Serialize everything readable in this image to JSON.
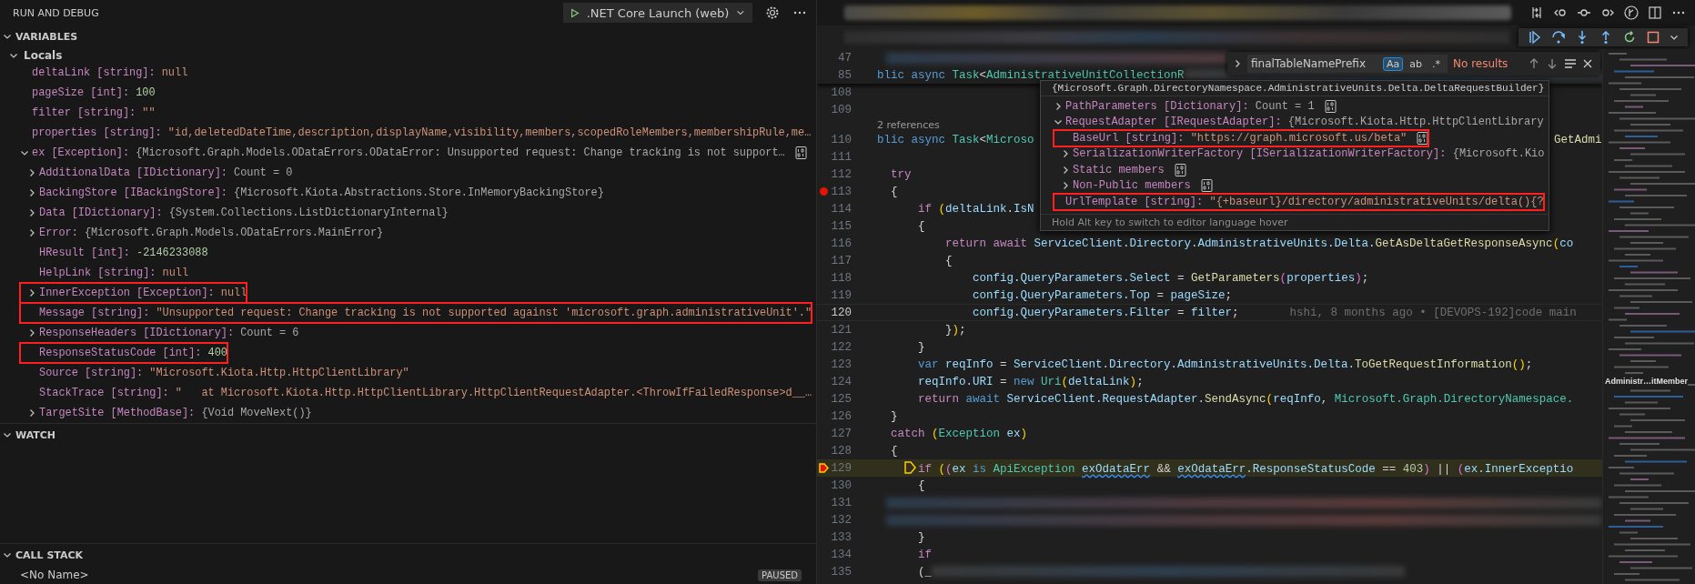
{
  "sidebar": {
    "title": "RUN AND DEBUG",
    "launch_config": ".NET Core Launch (web)",
    "variables": {
      "title": "VARIABLES",
      "expanded": true,
      "scopes": [
        {
          "name": "Locals",
          "expanded": true,
          "items": [
            {
              "name": "deltaLink",
              "type": "[string]:",
              "value": "null",
              "kind": "string",
              "expandable": false,
              "highlighted": false
            },
            {
              "name": "pageSize",
              "type": "[int]:",
              "value": "100",
              "kind": "number",
              "expandable": false,
              "highlighted": false
            },
            {
              "name": "filter",
              "type": "[string]:",
              "value": "\"\"",
              "kind": "string",
              "expandable": false,
              "highlighted": false
            },
            {
              "name": "properties",
              "type": "[string]:",
              "value": "\"id,deletedDateTime,description,displayName,visibility,members,scopedRoleMembers,membershipRule,me…",
              "kind": "string",
              "expandable": false,
              "highlighted": false
            },
            {
              "name": "ex",
              "type": "[Exception]:",
              "value": "{Microsoft.Graph.Models.ODataErrors.ODataError: Unsupported request: Change tracking is not support…",
              "kind": "object",
              "expandable": true,
              "expanded": true,
              "copy_button": true,
              "highlighted": false,
              "children": [
                {
                  "name": "AdditionalData",
                  "type": "[IDictionary]:",
                  "value": "Count = 0",
                  "kind": "object",
                  "expandable": true,
                  "expanded": false,
                  "highlighted": false
                },
                {
                  "name": "BackingStore",
                  "type": "[IBackingStore]:",
                  "value": "{Microsoft.Kiota.Abstractions.Store.InMemoryBackingStore}",
                  "kind": "object",
                  "expandable": true,
                  "expanded": false,
                  "highlighted": false
                },
                {
                  "name": "Data",
                  "type": "[IDictionary]:",
                  "value": "{System.Collections.ListDictionaryInternal}",
                  "kind": "object",
                  "expandable": true,
                  "expanded": false,
                  "highlighted": false
                },
                {
                  "name": "Error:",
                  "value": "{Microsoft.Graph.Models.ODataErrors.MainError}",
                  "kind": "object",
                  "expandable": true,
                  "expanded": false,
                  "highlighted": false
                },
                {
                  "name": "HResult",
                  "type": "[int]:",
                  "value": "-2146233088",
                  "kind": "number",
                  "expandable": false,
                  "highlighted": false
                },
                {
                  "name": "HelpLink",
                  "type": "[string]:",
                  "value": "null",
                  "kind": "string",
                  "expandable": false,
                  "highlighted": false
                },
                {
                  "name": "InnerException",
                  "type": "[Exception]:",
                  "value": "null",
                  "kind": "string",
                  "expandable": true,
                  "expanded": false,
                  "highlighted": true
                },
                {
                  "name": "Message",
                  "type": "[string]:",
                  "value": "\"Unsupported request: Change tracking is not supported against 'microsoft.graph.administrativeUnit'.\"",
                  "kind": "string",
                  "expandable": false,
                  "highlighted": true
                },
                {
                  "name": "ResponseHeaders",
                  "type": "[IDictionary]:",
                  "value": "Count = 6",
                  "kind": "object",
                  "expandable": true,
                  "expanded": false,
                  "highlighted": false
                },
                {
                  "name": "ResponseStatusCode",
                  "type": "[int]:",
                  "value": "400",
                  "kind": "number",
                  "expandable": false,
                  "highlighted": true
                },
                {
                  "name": "Source",
                  "type": "[string]:",
                  "value": "\"Microsoft.Kiota.Http.HttpClientLibrary\"",
                  "kind": "string",
                  "expandable": false,
                  "highlighted": false
                },
                {
                  "name": "StackTrace",
                  "type": "[string]:",
                  "value": "\"   at Microsoft.Kiota.Http.HttpClientLibrary.HttpClientRequestAdapter.<ThrowIfFailedResponse>d__…",
                  "kind": "string",
                  "expandable": false,
                  "highlighted": false
                },
                {
                  "name": "TargetSite",
                  "type": "[MethodBase]:",
                  "value": "{Void MoveNext()}",
                  "kind": "object",
                  "expandable": true,
                  "expanded": false,
                  "highlighted": false
                }
              ]
            }
          ]
        }
      ]
    },
    "watch": {
      "title": "WATCH",
      "expanded": true
    },
    "call_stack": {
      "title": "CALL STACK",
      "expanded": true,
      "frames": [
        {
          "name": "<No Name>",
          "badge": "PAUSED"
        }
      ]
    }
  },
  "editor": {
    "sticky_lines": [
      {
        "number": "47",
        "kind": "blurred"
      },
      {
        "number": "85",
        "kind": "normal",
        "tokens": [
          {
            "text": "blic async ",
            "kind": "kw"
          },
          {
            "text": "Task",
            "kind": "type"
          },
          {
            "text": "<",
            "kind": "p"
          },
          {
            "text": "AdministrativeUnitCollectionR",
            "kind": "type"
          },
          {
            "kind": "blur"
          }
        ]
      }
    ],
    "lines": [
      {
        "number": "108",
        "kind": "normal"
      },
      {
        "number": "109",
        "kind": "normal"
      },
      {
        "kind": "codelens",
        "text": "2 references"
      },
      {
        "number": "110",
        "kind": "normal",
        "tokens": [
          {
            "text": "blic async ",
            "kind": "kw"
          },
          {
            "text": "Task",
            "kind": "type"
          },
          {
            "text": "<",
            "kind": "p"
          },
          {
            "text": "Microso",
            "kind": "type"
          },
          {
            "text": "GetAdmi",
            "kind": "after_popup"
          }
        ]
      },
      {
        "number": "111",
        "kind": "normal"
      },
      {
        "number": "112",
        "kind": "normal",
        "tokens": [
          {
            "text": "  try",
            "kind": "ctl"
          }
        ]
      },
      {
        "number": "113",
        "kind": "breakpoint",
        "tokens": [
          {
            "text": "  {",
            "kind": "p"
          }
        ]
      },
      {
        "number": "114",
        "kind": "normal",
        "tokens": [
          {
            "text": "      if ",
            "kind": "ctl"
          },
          {
            "text": "(",
            "kind": "b1"
          },
          {
            "text": "deltaLink",
            "kind": "var"
          },
          {
            "text": ".",
            "kind": "p"
          },
          {
            "text": "IsN",
            "kind": "var"
          }
        ]
      },
      {
        "number": "115",
        "kind": "normal",
        "tokens": [
          {
            "text": "      {",
            "kind": "p"
          }
        ]
      },
      {
        "number": "116",
        "kind": "normal",
        "tokens": [
          {
            "text": "          return await ",
            "kind": "ctl"
          },
          {
            "text": "ServiceClient.Directory.AdministrativeUnits.Delta.",
            "kind": "var"
          },
          {
            "text": "GetAsDeltaGetResponseAsync",
            "kind": "fn"
          },
          {
            "text": "(",
            "kind": "b1"
          },
          {
            "text": "co",
            "kind": "var"
          }
        ]
      },
      {
        "number": "117",
        "kind": "normal",
        "tokens": [
          {
            "text": "          {",
            "kind": "p"
          }
        ]
      },
      {
        "number": "118",
        "kind": "normal",
        "tokens": [
          {
            "text": "              config.QueryParameters.Select",
            "kind": "var"
          },
          {
            "text": " = ",
            "kind": "p"
          },
          {
            "text": "GetParameters",
            "kind": "fn"
          },
          {
            "text": "(",
            "kind": "b2"
          },
          {
            "text": "properties",
            "kind": "var"
          },
          {
            "text": ")",
            "kind": "b2"
          },
          {
            "text": ";",
            "kind": "p"
          }
        ]
      },
      {
        "number": "119",
        "kind": "normal",
        "tokens": [
          {
            "text": "              config.QueryParameters.Top",
            "kind": "var"
          },
          {
            "text": " = ",
            "kind": "p"
          },
          {
            "text": "pageSize",
            "kind": "var"
          },
          {
            "text": ";",
            "kind": "p"
          }
        ]
      },
      {
        "number": "120",
        "kind": "current",
        "blame": "hshi, 8 months ago • [DEVOPS-192]code main",
        "tokens": [
          {
            "text": "              config.QueryParameters.Filter",
            "kind": "var"
          },
          {
            "text": " = ",
            "kind": "p"
          },
          {
            "text": "filter",
            "kind": "var"
          },
          {
            "text": ";",
            "kind": "p"
          }
        ]
      },
      {
        "number": "121",
        "kind": "normal",
        "tokens": [
          {
            "text": "          }",
            "kind": "p"
          },
          {
            "text": ")",
            "kind": "b1"
          },
          {
            "text": ";",
            "kind": "p"
          }
        ]
      },
      {
        "number": "122",
        "kind": "normal",
        "tokens": [
          {
            "text": "      }",
            "kind": "p"
          }
        ]
      },
      {
        "number": "123",
        "kind": "normal",
        "tokens": [
          {
            "text": "      var ",
            "kind": "kw"
          },
          {
            "text": "reqInfo",
            "kind": "var"
          },
          {
            "text": " = ",
            "kind": "p"
          },
          {
            "text": "ServiceClient.Directory.AdministrativeUnits.Delta.",
            "kind": "var"
          },
          {
            "text": "ToGetRequestInformation",
            "kind": "fn"
          },
          {
            "text": "()",
            "kind": "b1"
          },
          {
            "text": ";",
            "kind": "p"
          }
        ]
      },
      {
        "number": "124",
        "kind": "normal",
        "tokens": [
          {
            "text": "      reqInfo.URI",
            "kind": "var"
          },
          {
            "text": " = ",
            "kind": "p"
          },
          {
            "text": "new ",
            "kind": "kw"
          },
          {
            "text": "Uri",
            "kind": "type"
          },
          {
            "text": "(",
            "kind": "b1"
          },
          {
            "text": "deltaLink",
            "kind": "var"
          },
          {
            "text": ")",
            "kind": "b1"
          },
          {
            "text": ";",
            "kind": "p"
          }
        ]
      },
      {
        "number": "125",
        "kind": "normal",
        "tokens": [
          {
            "text": "      return ",
            "kind": "ctl"
          },
          {
            "text": "await ",
            "kind": "kw"
          },
          {
            "text": "ServiceClient.RequestAdapter.",
            "kind": "var"
          },
          {
            "text": "SendAsync",
            "kind": "fn"
          },
          {
            "text": "(",
            "kind": "b1"
          },
          {
            "text": "reqInfo",
            "kind": "var"
          },
          {
            "text": ", ",
            "kind": "p"
          },
          {
            "text": "Microsoft.Graph.DirectoryNamespace.",
            "kind": "type"
          }
        ]
      },
      {
        "number": "126",
        "kind": "normal",
        "tokens": [
          {
            "text": "  }",
            "kind": "p"
          }
        ]
      },
      {
        "number": "127",
        "kind": "normal",
        "tokens": [
          {
            "text": "  catch ",
            "kind": "ctl"
          },
          {
            "text": "(",
            "kind": "b1"
          },
          {
            "text": "Exception ",
            "kind": "type"
          },
          {
            "text": "ex",
            "kind": "var"
          },
          {
            "text": ")",
            "kind": "b1"
          }
        ]
      },
      {
        "number": "128",
        "kind": "normal",
        "tokens": [
          {
            "text": "  {",
            "kind": "p"
          }
        ]
      },
      {
        "number": "129",
        "kind": "paused",
        "tokens": [
          {
            "kind": "marker"
          },
          {
            "text": "if ",
            "kind": "ctl"
          },
          {
            "text": "(",
            "kind": "b1"
          },
          {
            "text": "(",
            "kind": "b2"
          },
          {
            "text": "ex ",
            "kind": "var"
          },
          {
            "text": "is ",
            "kind": "kw"
          },
          {
            "text": "ApiException ",
            "kind": "type"
          },
          {
            "text": "exOdataErr",
            "kind": "warn"
          },
          {
            "text": " && ",
            "kind": "p"
          },
          {
            "text": "exOdataErr",
            "kind": "warn"
          },
          {
            "text": ".ResponseStatusCode",
            "kind": "var"
          },
          {
            "text": " == ",
            "kind": "p"
          },
          {
            "text": "403",
            "kind": "num"
          },
          {
            "text": ")",
            "kind": "b2"
          },
          {
            "text": " || ",
            "kind": "p"
          },
          {
            "text": "(",
            "kind": "b2"
          },
          {
            "text": "ex.InnerExceptio",
            "kind": "var"
          }
        ]
      },
      {
        "number": "130",
        "kind": "normal",
        "tokens": [
          {
            "text": "      {",
            "kind": "p"
          }
        ]
      },
      {
        "number": "131",
        "kind": "blurred"
      },
      {
        "number": "132",
        "kind": "blurred"
      },
      {
        "number": "133",
        "kind": "normal",
        "tokens": [
          {
            "text": "      }",
            "kind": "p"
          }
        ]
      },
      {
        "number": "134",
        "kind": "normal",
        "tokens": [
          {
            "text": "      if",
            "kind": "ctl"
          }
        ]
      },
      {
        "number": "135",
        "kind": "normal",
        "tokens": [
          {
            "text": "      (_",
            "kind": "p"
          },
          {
            "kind": "blur"
          }
        ]
      }
    ],
    "find": {
      "query": "finalTableNamePrefix",
      "options": [
        {
          "label": "Aa",
          "selected": true
        },
        {
          "label": "ab",
          "selected": false
        },
        {
          "label": ".*",
          "selected": false
        }
      ],
      "result": "No results"
    },
    "hover": {
      "title": "{Microsoft.Graph.DirectoryNamespace.AdministrativeUnits.Delta.DeltaRequestBuilder}",
      "items": [
        {
          "name": "PathParameters",
          "type": "[Dictionary]:",
          "value": "Count = 1",
          "kind": "object",
          "expandable": true,
          "expanded": false,
          "copy_button": true,
          "highlighted": false
        },
        {
          "name": "RequestAdapter",
          "type": "[IRequestAdapter]:",
          "value": "{Microsoft.Kiota.Http.HttpClientLibrary",
          "kind": "object",
          "expandable": true,
          "expanded": true,
          "highlighted": false,
          "children": [
            {
              "name": "BaseUrl",
              "type": "[string]:",
              "value": "\"https://graph.microsoft.us/beta\"",
              "kind": "string",
              "expandable": false,
              "copy_button": true,
              "highlighted": true
            },
            {
              "name": "SerializationWriterFactory",
              "type": "[ISerializationWriterFactory]:",
              "value": "{Microsoft.Kio",
              "kind": "object",
              "expandable": true,
              "expanded": false,
              "highlighted": false
            },
            {
              "name": "Static members",
              "expandable": true,
              "expanded": false,
              "copy_button": true,
              "highlighted": false
            },
            {
              "name": "Non-Public members",
              "expandable": true,
              "expanded": false,
              "copy_button": true,
              "highlighted": false
            }
          ]
        },
        {
          "name": "UrlTemplate",
          "type": "[string]:",
          "value": "\"{+baseurl}/directory/administrativeUnits/delta(){?",
          "kind": "string",
          "expandable": false,
          "highlighted": true
        }
      ],
      "footer": "Hold Alt key to switch to editor language hover"
    },
    "minimap": {
      "label": "Administr…itMember"
    }
  }
}
